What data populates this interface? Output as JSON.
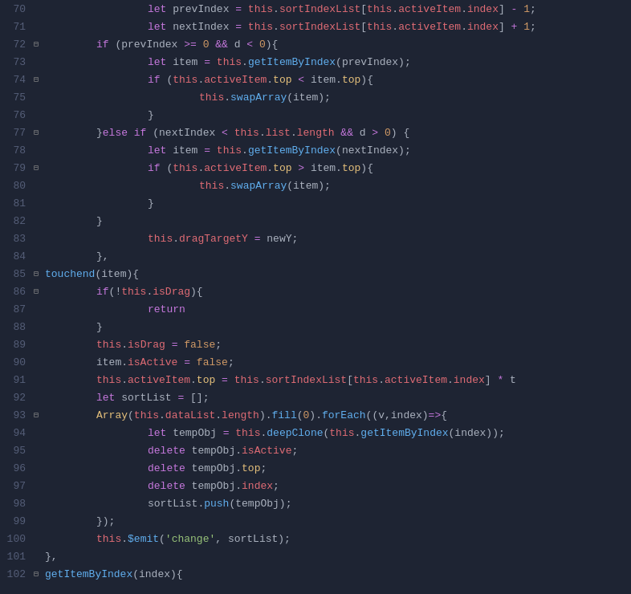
{
  "editor": {
    "background": "#1e2433",
    "lines": [
      {
        "num": 70,
        "fold": false,
        "indent": 8,
        "content": "let prevIndex = this.sortIndexList[this.activeItem.index] - 1;"
      },
      {
        "num": 71,
        "fold": false,
        "indent": 8,
        "content": "let nextIndex = this.sortIndexList[this.activeItem.index] + 1;"
      },
      {
        "num": 72,
        "fold": true,
        "indent": 4,
        "content": "if (prevIndex >= 0 && d < 0){"
      },
      {
        "num": 73,
        "fold": false,
        "indent": 8,
        "content": "let item = this.getItemByIndex(prevIndex);"
      },
      {
        "num": 74,
        "fold": true,
        "indent": 8,
        "content": "if (this.activeItem.top < item.top){"
      },
      {
        "num": 75,
        "fold": false,
        "indent": 12,
        "content": "this.swapArray(item);"
      },
      {
        "num": 76,
        "fold": false,
        "indent": 8,
        "content": "}"
      },
      {
        "num": 77,
        "fold": true,
        "indent": 4,
        "content": "}else if (nextIndex < this.list.length && d > 0) {"
      },
      {
        "num": 78,
        "fold": false,
        "indent": 8,
        "content": "let item = this.getItemByIndex(nextIndex);"
      },
      {
        "num": 79,
        "fold": true,
        "indent": 8,
        "content": "if (this.activeItem.top > item.top){"
      },
      {
        "num": 80,
        "fold": false,
        "indent": 12,
        "content": "this.swapArray(item);"
      },
      {
        "num": 81,
        "fold": false,
        "indent": 8,
        "content": "}"
      },
      {
        "num": 82,
        "fold": false,
        "indent": 4,
        "content": "}"
      },
      {
        "num": 83,
        "fold": false,
        "indent": 8,
        "content": "this.dragTargetY = newY;"
      },
      {
        "num": 84,
        "fold": false,
        "indent": 4,
        "content": "},"
      },
      {
        "num": 85,
        "fold": true,
        "indent": 0,
        "content": "touchend(item){"
      },
      {
        "num": 86,
        "fold": true,
        "indent": 4,
        "content": "if(!this.isDrag){"
      },
      {
        "num": 87,
        "fold": false,
        "indent": 8,
        "content": "return"
      },
      {
        "num": 88,
        "fold": false,
        "indent": 4,
        "content": "}"
      },
      {
        "num": 89,
        "fold": false,
        "indent": 4,
        "content": "this.isDrag = false;"
      },
      {
        "num": 90,
        "fold": false,
        "indent": 4,
        "content": "item.isActive = false;"
      },
      {
        "num": 91,
        "fold": false,
        "indent": 4,
        "content": "this.activeItem.top = this.sortIndexList[this.activeItem.index] * t"
      },
      {
        "num": 92,
        "fold": false,
        "indent": 4,
        "content": "let sortList = [];"
      },
      {
        "num": 93,
        "fold": true,
        "indent": 4,
        "content": "Array(this.dataList.length).fill(0).forEach((v,index)=>{"
      },
      {
        "num": 94,
        "fold": false,
        "indent": 8,
        "content": "let tempObj = this.deepClone(this.getItemByIndex(index));"
      },
      {
        "num": 95,
        "fold": false,
        "indent": 8,
        "content": "delete tempObj.isActive;"
      },
      {
        "num": 96,
        "fold": false,
        "indent": 8,
        "content": "delete tempObj.top;"
      },
      {
        "num": 97,
        "fold": false,
        "indent": 8,
        "content": "delete tempObj.index;"
      },
      {
        "num": 98,
        "fold": false,
        "indent": 8,
        "content": "sortList.push(tempObj);"
      },
      {
        "num": 99,
        "fold": false,
        "indent": 4,
        "content": "});"
      },
      {
        "num": 100,
        "fold": false,
        "indent": 4,
        "content": "this.$emit('change', sortList);"
      },
      {
        "num": 101,
        "fold": false,
        "indent": 0,
        "content": "},"
      },
      {
        "num": 102,
        "fold": true,
        "indent": 0,
        "content": "getItemByIndex(index){"
      }
    ]
  }
}
